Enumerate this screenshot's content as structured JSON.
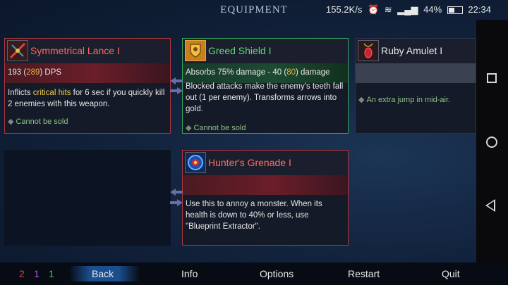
{
  "header": {
    "title": "EQUIPMENT"
  },
  "status": {
    "speed": "155.2K/s",
    "icons": [
      "alarm-icon",
      "wifi-icon",
      "signal-icon"
    ],
    "battery": "44%",
    "time": "22:34",
    "battery_level": 0.44
  },
  "cards": {
    "lance": {
      "name": "Symmetrical Lance I",
      "dps_prefix": "193 (",
      "dps_value": "289",
      "dps_suffix": ") DPS",
      "desc_a": "Inflicts ",
      "desc_b": "critical hits",
      "desc_c": " for 6 sec if you quickly kill 2 enemies with this weapon.",
      "note": "Cannot be sold",
      "icon": "lance-icon"
    },
    "shield": {
      "name": "Greed Shield I",
      "stat_prefix": "Absorbs 75% damage - 40 (",
      "stat_value": "80",
      "stat_suffix": ") damage",
      "desc": "Blocked attacks make the enemy's teeth fall out (1 per enemy). Transforms arrows into gold.",
      "note": "Cannot be sold",
      "icon": "shield-icon"
    },
    "amulet": {
      "name": "Ruby Amulet I",
      "note": "An extra jump in mid-air.",
      "icon": "amulet-icon"
    },
    "grenade": {
      "name": "Hunter's Grenade I",
      "desc": "Use this to annoy a monster. When its health is down to 40% or less, use \"Blueprint Extractor\".",
      "icon": "grenade-icon"
    }
  },
  "bottom": {
    "counters": [
      {
        "value": "2",
        "color": "#e0403a"
      },
      {
        "value": "1",
        "color": "#b054d8"
      },
      {
        "value": "1",
        "color": "#4fc05a"
      }
    ],
    "back": "Back",
    "info": "Info",
    "options": "Options",
    "restart": "Restart",
    "quit": "Quit"
  },
  "android_nav": [
    "recent-apps-icon",
    "home-icon",
    "back-icon"
  ]
}
